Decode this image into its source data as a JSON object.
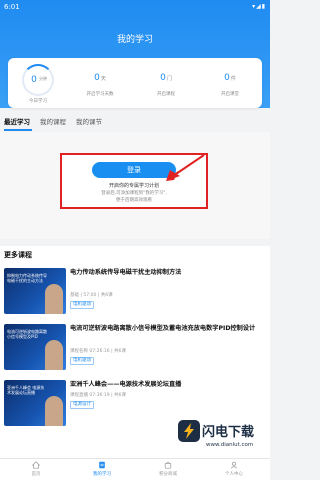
{
  "statusbar": {
    "time": "6:01",
    "system": "▾◢▮"
  },
  "header": {
    "title": "我的学习"
  },
  "stats": [
    {
      "value": "0",
      "unit": "分钟",
      "label": "今日学习",
      "ring": true
    },
    {
      "value": "0",
      "unit": "天",
      "label": "开启学习天数",
      "ring": false
    },
    {
      "value": "0",
      "unit": "门",
      "label": "开启课程",
      "ring": false
    },
    {
      "value": "0",
      "unit": "件",
      "label": "开启课堂",
      "ring": false
    }
  ],
  "tabs": {
    "recent": "最近学习",
    "courses": "我的课程",
    "lessons": "我的课节"
  },
  "login": {
    "button": "登录",
    "subtitle": "开启你的专属学习计划",
    "hint_line1": "登录后,可添加课程到\"我的学习\",",
    "hint_line2": "便于后期高效观看"
  },
  "more": {
    "title": "更多课程",
    "courses": [
      {
        "title": "电力传动系统传导电磁干扰主动抑制方法",
        "thumb_text": "抑制电力传动系统传导电磁干扰的主动方法",
        "meta": "基础 | 57:00 | 共6课",
        "tag": "电机驱动"
      },
      {
        "title": "电流可逆斩波电路离散小信号模型及蓄电池充放电数字PID控制设计",
        "thumb_text": "电流可逆斩波电路离散小信号模型及PID",
        "meta": "课程名称 07:26:16 | 共6课",
        "tag": "电机驱动"
      },
      {
        "title": "亚洲千人峰会——电源技术发展论坛直播",
        "thumb_text": "亚洲千人峰会 电源技术发展论坛直播",
        "meta": "课程直播 07:36:19 | 共6课",
        "tag": "电源设计"
      }
    ]
  },
  "watermark": {
    "name": "闪电下载",
    "url": "www.dianlut.com"
  },
  "nav": [
    {
      "label": "首页",
      "icon": "home-icon"
    },
    {
      "label": "我的学习",
      "icon": "study-icon"
    },
    {
      "label": "积分商城",
      "icon": "mall-icon"
    },
    {
      "label": "个人中心",
      "icon": "user-icon"
    }
  ],
  "colors": {
    "primary": "#1f8bf1",
    "highlight": "#e02222"
  }
}
